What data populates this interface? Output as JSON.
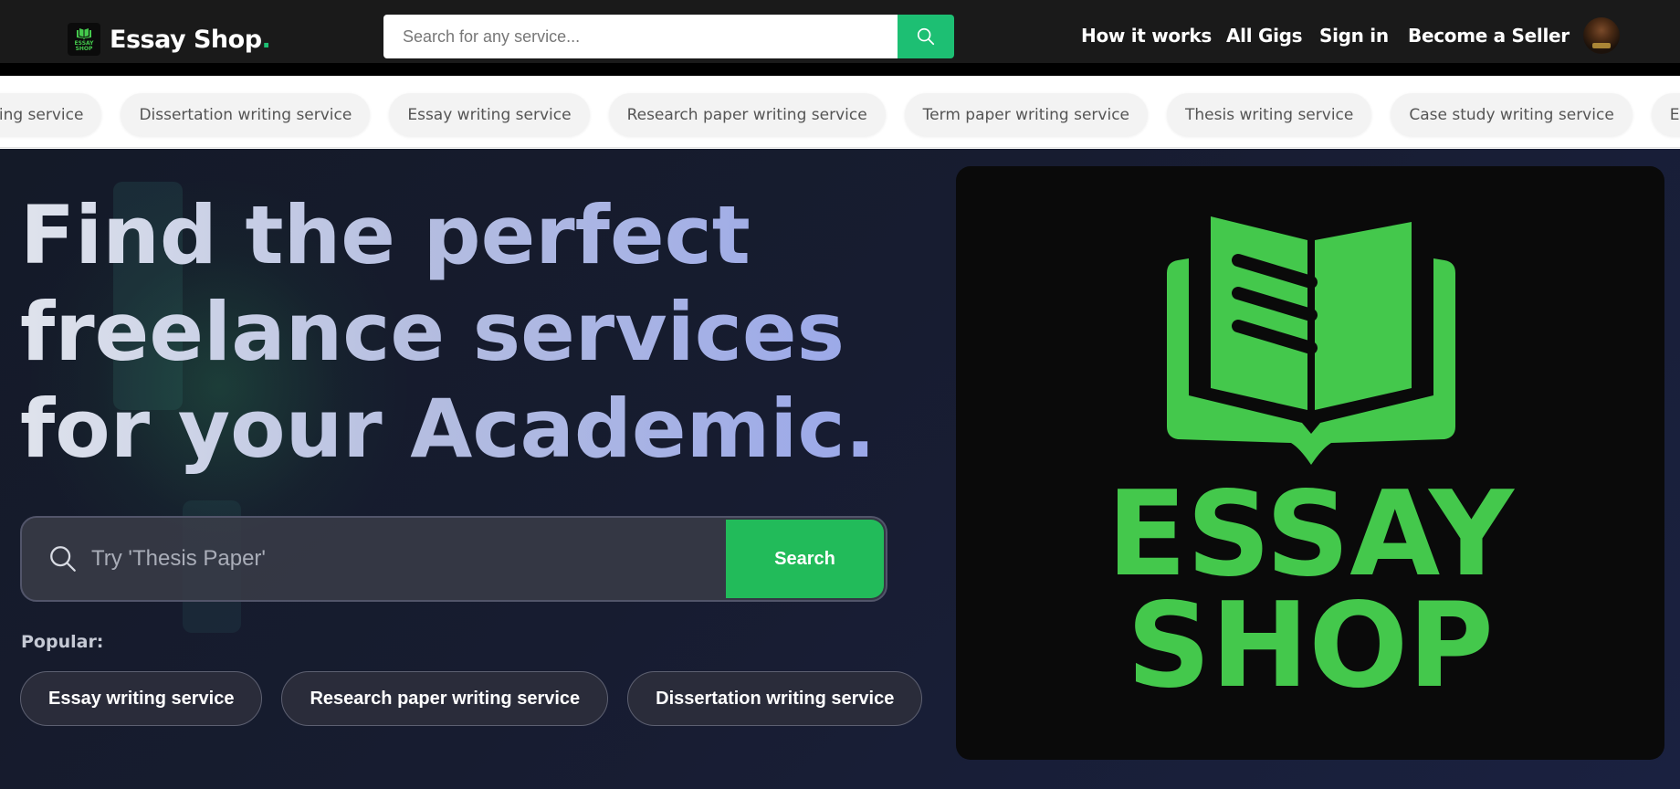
{
  "header": {
    "brand_name": "Essay Shop",
    "brand_dot": ".",
    "brand_logo_text": "ESSAY SHOP",
    "search_placeholder": "Search for any service...",
    "nav": {
      "how_it_works": "How it works",
      "all_gigs": "All Gigs",
      "sign_in": "Sign in",
      "become_seller": "Become a Seller"
    }
  },
  "categories": [
    "Case study writing service",
    "Dissertation writing service",
    "Essay writing service",
    "Research paper writing service",
    "Term paper writing service",
    "Thesis writing service",
    "Case study writing service",
    "Essay writing service"
  ],
  "hero": {
    "title_lines": [
      "Find the perfect",
      "freelance services",
      "for your Academic."
    ],
    "search_placeholder": "Try 'Thesis Paper'",
    "search_button": "Search",
    "popular_label": "Popular:",
    "popular_tags": [
      "Essay writing service",
      "Research paper writing service",
      "Dissertation writing service"
    ],
    "logo_line1": "ESSAY",
    "logo_line2": "SHOP"
  },
  "colors": {
    "header_bg": "#1a1a1a",
    "accent_green": "#1dbf73",
    "logo_green": "#44c84c",
    "hero_bg": "#171c30",
    "search_button": "#22bb5a"
  },
  "icons": {
    "top_search": "search-icon",
    "hero_search": "search-icon",
    "logo": "open-book-icon"
  }
}
